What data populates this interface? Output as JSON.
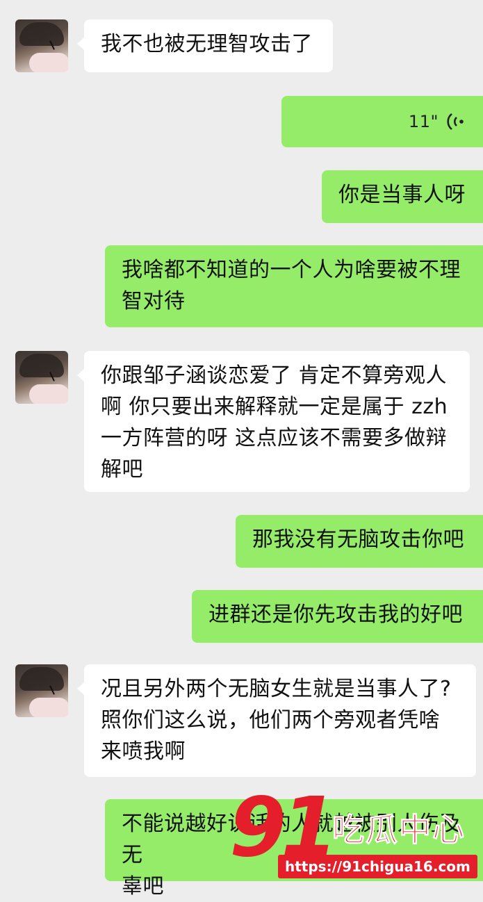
{
  "messages": [
    {
      "side": "in",
      "text": "我不也被无理智攻击了"
    },
    {
      "side": "out",
      "type": "voice",
      "duration": "11\""
    },
    {
      "side": "out",
      "text": "你是当事人呀"
    },
    {
      "side": "out",
      "lines": [
        "我啥都不知道的一个人为啥要被不理",
        "智对待"
      ]
    },
    {
      "side": "in",
      "lines": [
        "你跟邹子涵谈恋爱了 肯定不算旁观人",
        "啊 你只要出来解释就一定是属于 zzh",
        "一方阵营的呀 这点应该不需要多做辩",
        "解吧"
      ]
    },
    {
      "side": "out",
      "text": "那我没有无脑攻击你吧"
    },
    {
      "side": "out",
      "text": "进群还是你先攻击我的好吧"
    },
    {
      "side": "in",
      "lines": [
        "况且另外两个无脑女生就是当事人了?",
        "照你们这么说，他们两个旁观者凭啥",
        "来喷我啊"
      ]
    },
    {
      "side": "out",
      "lines": [
        "不能说越好说话的人就越被别人伤及无",
        "辜吧"
      ]
    }
  ],
  "watermark": {
    "brand_number": "91",
    "brand_text": "吃瓜中心",
    "url": "https://91chigua16.com"
  },
  "colors": {
    "background": "#ededed",
    "incoming": "#ffffff",
    "outgoing": "#95ec69",
    "watermark": "#e41e2b"
  }
}
